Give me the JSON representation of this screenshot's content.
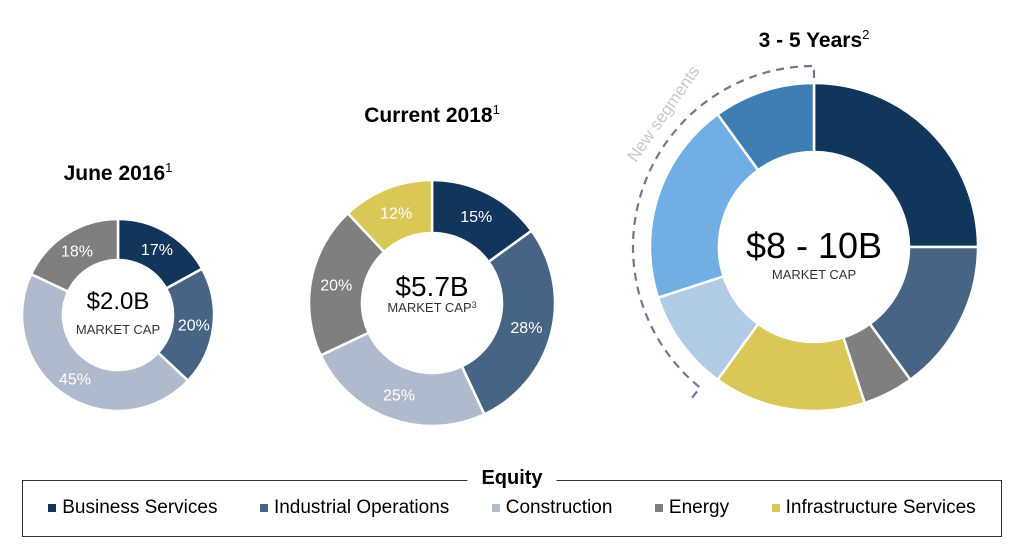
{
  "chart_data": [
    {
      "type": "pie",
      "title": "June 2016",
      "title_sup": "1",
      "center_value": "$2.0B",
      "center_label": "MARKET CAP",
      "center_sup": "",
      "categories": [
        "Business Services",
        "Industrial Operations",
        "Construction",
        "Energy"
      ],
      "values": [
        17,
        20,
        45,
        18
      ],
      "labels": [
        "17%",
        "20%",
        "45%",
        "18%"
      ],
      "colors": [
        "#12355B",
        "#476485",
        "#B0BACD",
        "#7F7F7F"
      ]
    },
    {
      "type": "pie",
      "title": "Current 2018",
      "title_sup": "1",
      "center_value": "$5.7B",
      "center_label": "MARKET CAP",
      "center_sup": "3",
      "categories": [
        "Business Services",
        "Industrial Operations",
        "Construction",
        "Energy",
        "Infrastructure Services"
      ],
      "values": [
        15,
        28,
        25,
        20,
        12
      ],
      "labels": [
        "15%",
        "28%",
        "25%",
        "20%",
        "12%"
      ],
      "colors": [
        "#12355B",
        "#476485",
        "#B0BACD",
        "#7F7F7F",
        "#D9C857"
      ]
    },
    {
      "type": "pie",
      "title": "3 - 5 Years",
      "title_sup": "2",
      "center_value": "$8 - 10B",
      "center_label": "MARKET CAP",
      "center_sup": "",
      "categories": [
        "Business Services",
        "Industrial Operations",
        "Energy",
        "Infrastructure Services",
        "Construction",
        "New segment",
        "New segment"
      ],
      "values": [
        25,
        15,
        5,
        15,
        10,
        20,
        10
      ],
      "labels": [
        "",
        "",
        "",
        "",
        "",
        "",
        ""
      ],
      "colors": [
        "#12355B",
        "#476485",
        "#7F7F7F",
        "#D9C857",
        "#B1CBE4",
        "#70AEE4",
        "#3F7EB3"
      ],
      "annotation": "New segments"
    }
  ],
  "legend": {
    "title": "Equity",
    "items": [
      {
        "label": "Business Services",
        "color": "#12355B"
      },
      {
        "label": "Industrial Operations",
        "color": "#476485"
      },
      {
        "label": "Construction",
        "color": "#B0BACD"
      },
      {
        "label": "Energy",
        "color": "#7F7F7F"
      },
      {
        "label": "Infrastructure Services",
        "color": "#D9C857"
      }
    ]
  }
}
